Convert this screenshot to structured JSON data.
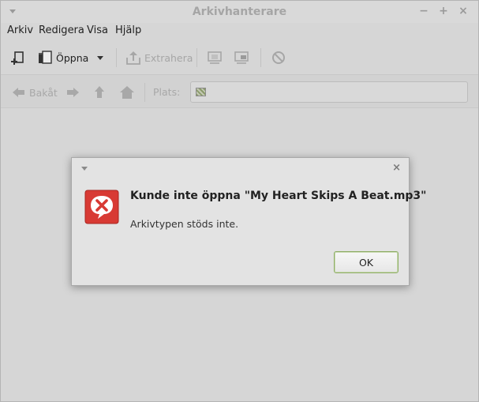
{
  "window": {
    "title": "Arkivhanterare",
    "minimize": "−",
    "maximize": "+",
    "close": "×"
  },
  "menu": {
    "items": [
      "Arkiv",
      "Redigera",
      "Visa",
      "Hjälp"
    ]
  },
  "toolbar": {
    "open_label": "Öppna",
    "extract_label": "Extrahera"
  },
  "location": {
    "back_label": "Bakåt",
    "place_label": "Plats:",
    "place_value": ""
  },
  "dialog": {
    "close": "×",
    "heading": "Kunde inte öppna \"My Heart Skips A Beat.mp3\"",
    "message": "Arkivtypen stöds inte.",
    "ok_label": "OK"
  },
  "colors": {
    "accent_green": "#8fae67",
    "error_red": "#d83a34"
  }
}
